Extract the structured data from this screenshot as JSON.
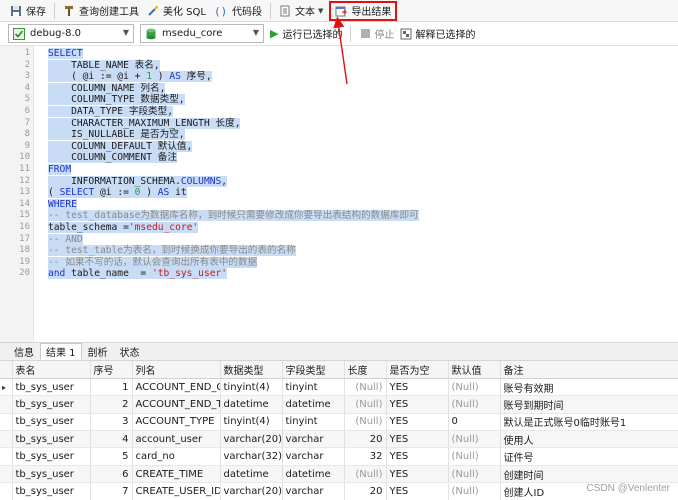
{
  "toolbar": {
    "save": "保存",
    "query_builder": "查询创建工具",
    "beautify": "美化 SQL",
    "snippet": "代码段",
    "text": "文本",
    "export": "导出结果",
    "icons": [
      "save-icon",
      "hammer-icon",
      "wand-icon",
      "brackets-icon",
      "document-icon",
      "export-icon"
    ]
  },
  "connbar": {
    "connection": "debug-8.0",
    "database": "msedu_core",
    "run_selected": "运行已选择的",
    "stop": "停止",
    "explain": "解释已选择的"
  },
  "editor": {
    "line_numbers": [
      "1",
      "2",
      "3",
      "4",
      "5",
      "6",
      "7",
      "8",
      "9",
      "10",
      "11",
      "12",
      "13",
      "14",
      "15",
      "16",
      "17",
      "18",
      "19",
      "20"
    ]
  },
  "tabs": [
    "信息",
    "结果 1",
    "剖析",
    "状态"
  ],
  "result": {
    "columns": [
      "表名",
      "序号",
      "列名",
      "数据类型",
      "字段类型",
      "长度",
      "是否为空",
      "默认值",
      "备注"
    ],
    "rows": [
      [
        "tb_sys_user",
        "1",
        "ACCOUNT_END_G",
        "tinyint(4)",
        "tinyint",
        "(Null)",
        "YES",
        "(Null)",
        "账号有效期"
      ],
      [
        "tb_sys_user",
        "2",
        "ACCOUNT_END_TI",
        "datetime",
        "datetime",
        "(Null)",
        "YES",
        "(Null)",
        "账号到期时间"
      ],
      [
        "tb_sys_user",
        "3",
        "ACCOUNT_TYPE",
        "tinyint(4)",
        "tinyint",
        "(Null)",
        "YES",
        "0",
        "默认是正式账号0临时账号1"
      ],
      [
        "tb_sys_user",
        "4",
        "account_user",
        "varchar(20)",
        "varchar",
        "20",
        "YES",
        "(Null)",
        "使用人"
      ],
      [
        "tb_sys_user",
        "5",
        "card_no",
        "varchar(32)",
        "varchar",
        "32",
        "YES",
        "(Null)",
        "证件号"
      ],
      [
        "tb_sys_user",
        "6",
        "CREATE_TIME",
        "datetime",
        "datetime",
        "(Null)",
        "YES",
        "(Null)",
        "创建时间"
      ],
      [
        "tb_sys_user",
        "7",
        "CREATE_USER_ID",
        "varchar(20)",
        "varchar",
        "20",
        "YES",
        "(Null)",
        "创建人ID"
      ]
    ]
  },
  "watermark": "CSDN @Venlenter",
  "colors": {
    "highlight": "#e01010",
    "selection": "#c9dcf5",
    "keyword": "#1a33cc"
  }
}
